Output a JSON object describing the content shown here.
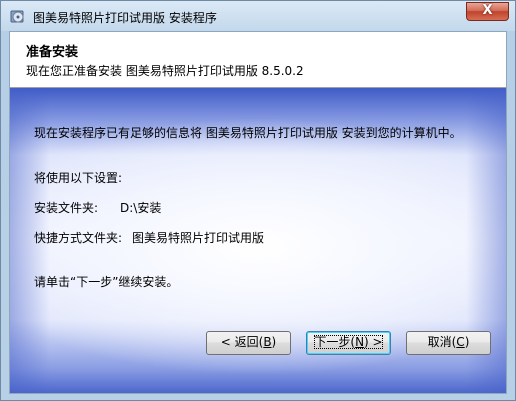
{
  "window": {
    "title": "图美易特照片打印试用版 安装程序",
    "close_label": "X"
  },
  "header": {
    "heading": "准备安装",
    "subheading": "现在您正准备安装 图美易特照片打印试用版 8.5.0.2"
  },
  "body": {
    "intro": "现在安装程序已有足够的信息将 图美易特照片打印试用版 安装到您的计算机中。",
    "settings_label": "将使用以下设置:",
    "install_folder_label": "安装文件夹:",
    "install_folder_value": "D:\\安装",
    "shortcut_folder_label": "快捷方式文件夹:",
    "shortcut_folder_value": "图美易特照片打印试用版",
    "continue_hint": "请单击“下一步”继续安装。"
  },
  "buttons": {
    "back_prefix": "< 返回(",
    "back_key": "B",
    "back_suffix": ")",
    "next_prefix": "下一步(",
    "next_key": "N",
    "next_suffix": ") >",
    "cancel_prefix": "取消(",
    "cancel_key": "C",
    "cancel_suffix": ")"
  },
  "colors": {
    "panel_edge": "#3f5cc7",
    "panel_center": "#ffffff",
    "close_button": "#c0432c"
  },
  "icons": {
    "app": "installer-cd-icon"
  }
}
